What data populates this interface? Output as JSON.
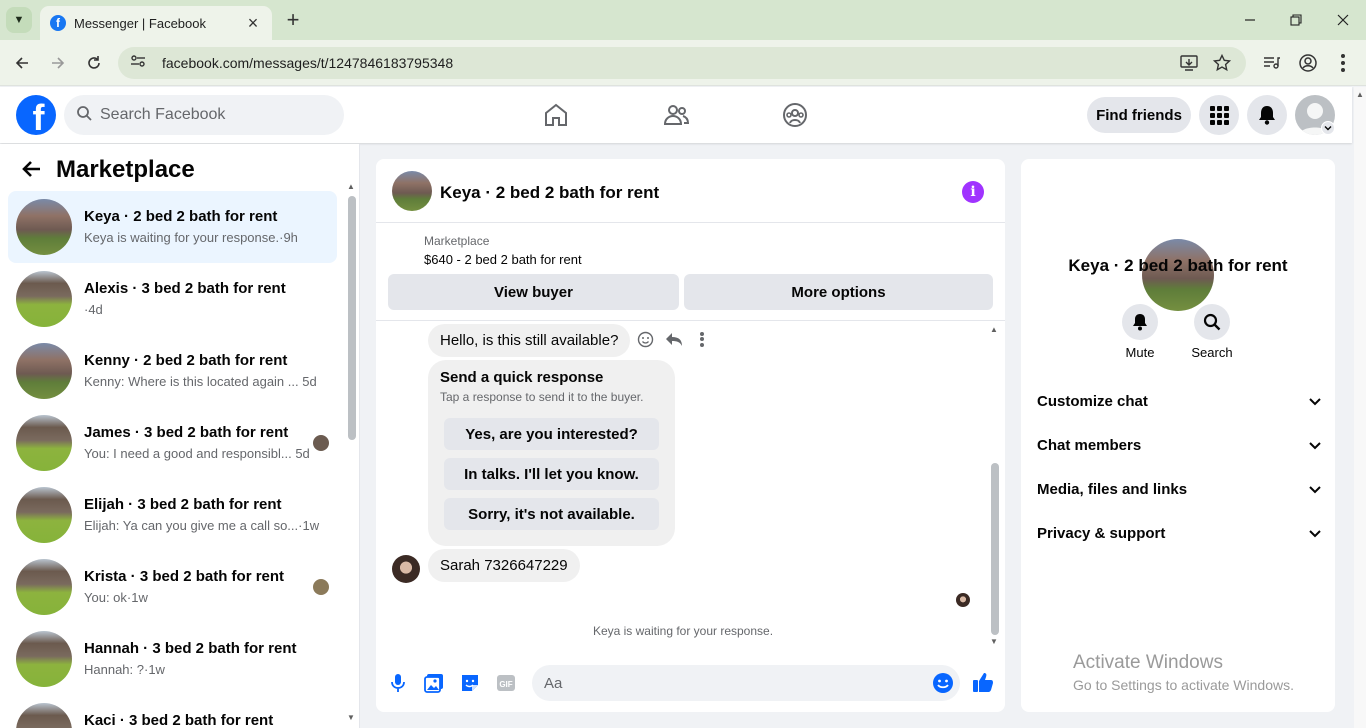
{
  "browser": {
    "tab_title": "Messenger | Facebook",
    "url": "facebook.com/messages/t/1247846183795348"
  },
  "fb": {
    "search_placeholder": "Search Facebook",
    "find_friends": "Find friends"
  },
  "sidebar": {
    "title": "Marketplace",
    "conversations": [
      {
        "name": "Keya · 2 bed 2 bath for rent",
        "sub": "Keya is waiting for your response.",
        "time": "·9h"
      },
      {
        "name": "Alexis · 3 bed 2 bath for rent",
        "sub": "·4d",
        "time": ""
      },
      {
        "name": "Kenny · 2 bed 2 bath for rent",
        "sub": "Kenny: Where is this located again ...",
        "time": "5d"
      },
      {
        "name": "James · 3 bed 2 bath for rent",
        "sub": "You: I need a good and responsibl...",
        "time": "5d"
      },
      {
        "name": "Elijah · 3 bed 2 bath for rent",
        "sub": "Elijah: Ya can you give me a call so...",
        "time": "·1w"
      },
      {
        "name": "Krista · 3 bed 2 bath for rent",
        "sub": "You: ok",
        "time": "·1w"
      },
      {
        "name": "Hannah · 3 bed 2 bath for rent",
        "sub": "Hannah: ?",
        "time": "·1w"
      },
      {
        "name": "Kaci · 3 bed 2 bath for rent",
        "sub": "",
        "time": ""
      }
    ]
  },
  "chat": {
    "title": "Keya · 2 bed 2 bath for rent",
    "marketplace_label": "Marketplace",
    "listing": "$640 - 2 bed 2 bath for rent",
    "view_buyer": "View buyer",
    "more_options": "More options",
    "message1": "Hello, is this still available?",
    "quick_title": "Send a quick response",
    "quick_sub": "Tap a response to send it to the buyer.",
    "quick_options": [
      "Yes, are you interested?",
      "In talks. I'll let you know.",
      "Sorry, it's not available."
    ],
    "message2": "Sarah 7326647229",
    "waiting": "Keya is waiting for your response.",
    "composer_placeholder": "Aa"
  },
  "details": {
    "name": "Keya · 2 bed 2 bath for rent",
    "mute": "Mute",
    "search": "Search",
    "sections": [
      "Customize chat",
      "Chat members",
      "Media, files and links",
      "Privacy & support"
    ]
  },
  "watermark": {
    "line1": "Activate Windows",
    "line2": "Go to Settings to activate Windows."
  },
  "colors": {
    "brand": "#0866ff",
    "accent": "#a033ff",
    "active_bg": "#ebf5ff"
  }
}
